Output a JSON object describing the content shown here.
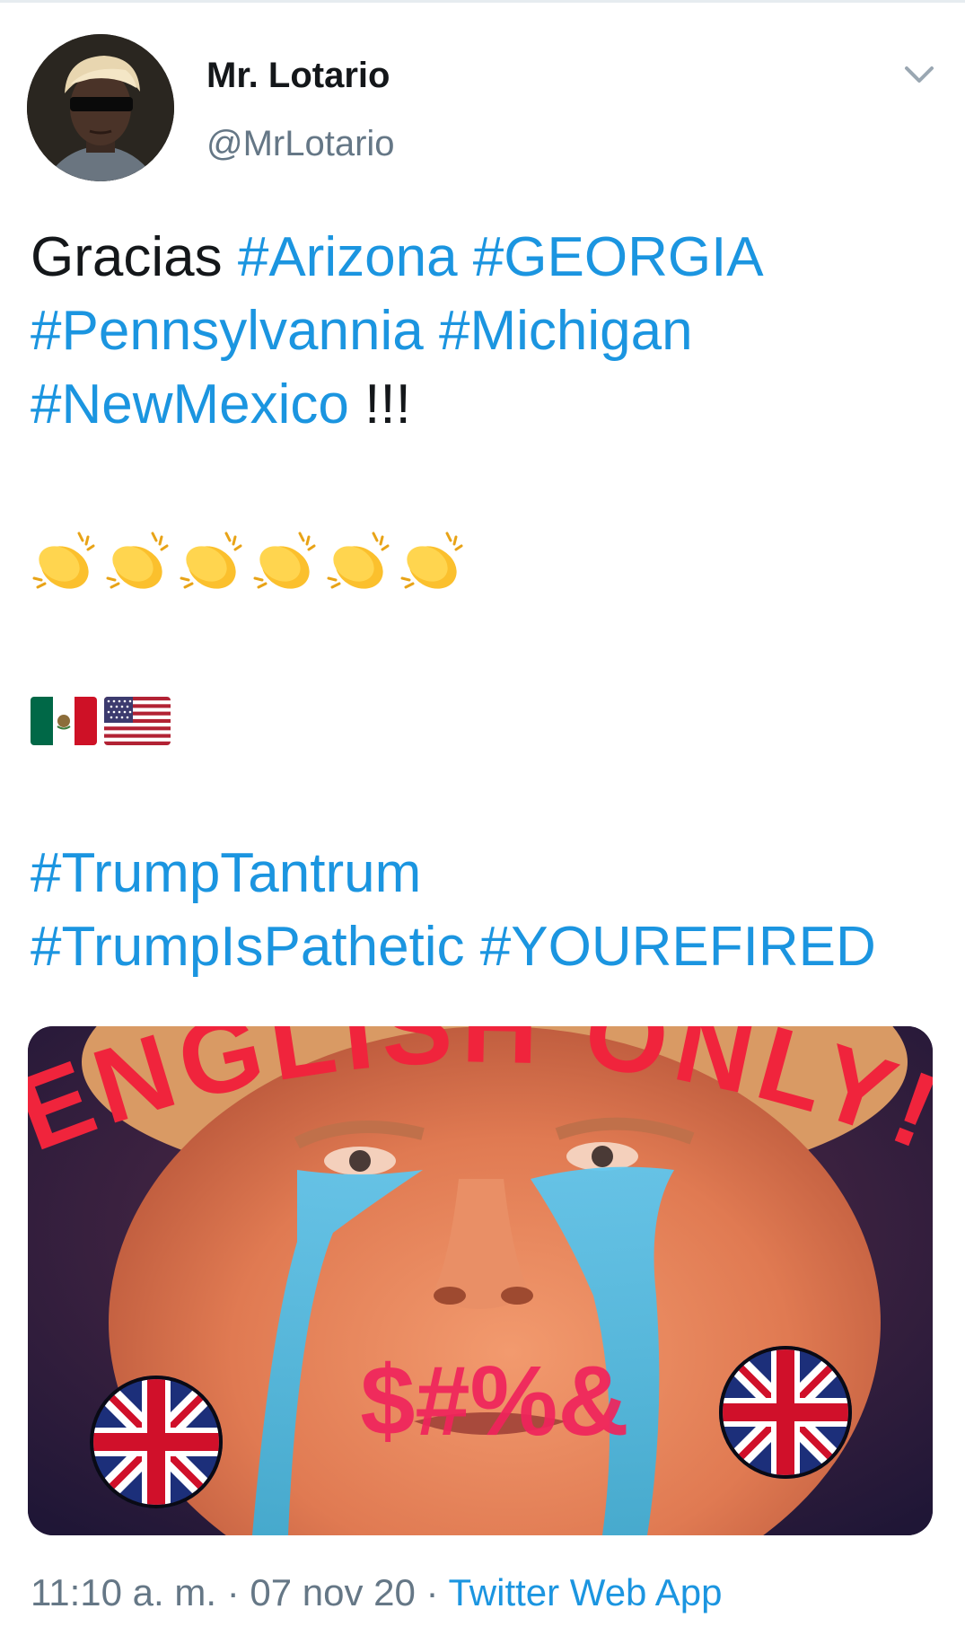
{
  "tweet": {
    "author": {
      "display_name": "Mr. Lotario",
      "handle": "@MrLotario",
      "avatar_icon": "avatar-man-sunglasses"
    },
    "text": {
      "word_gracias": "Gracias",
      "tag_arizona": "#Arizona",
      "tag_georgia": "#GEORGIA",
      "tag_pennsylvannia": "#Pennsylvannia",
      "tag_michigan": "#Michigan",
      "tag_newmexico": "#NewMexico",
      "exclaim": "!!!",
      "clap_emoji_count": 6,
      "flags": [
        "flag-mexico",
        "flag-usa"
      ],
      "tag_trumptantrum": "#TrumpTantrum",
      "tag_trumpispathetic": "#TrumpIsPathetic",
      "tag_yourefired": "#YOUREFIRED"
    },
    "media": {
      "overlay_top": "ENGLISH ONLY!",
      "overlay_mouth": "$#%&"
    },
    "meta": {
      "time": "11:10 a. m.",
      "separator": "·",
      "date": "07 nov 20",
      "source": "Twitter Web App"
    },
    "colors": {
      "link": "#1b95e0",
      "text": "#14171a",
      "secondary": "#657786"
    }
  }
}
